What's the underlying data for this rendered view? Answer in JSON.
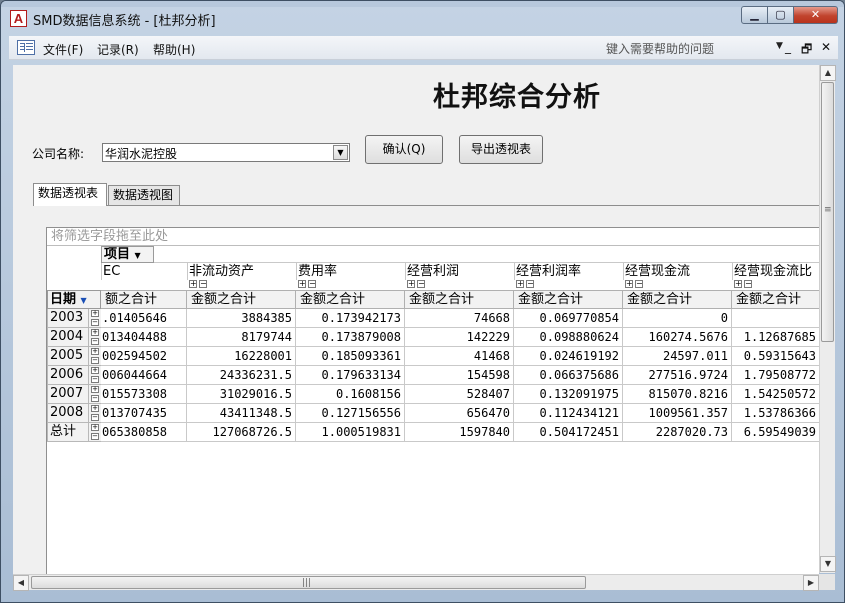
{
  "window": {
    "title": "SMD数据信息系统 - [杜邦分析]",
    "app_icon_letter": "A"
  },
  "caption": {
    "min": "▁",
    "max": "▢",
    "close": "✕"
  },
  "menu": {
    "items": [
      "文件(F)",
      "记录(R)",
      "帮助(H)"
    ],
    "help_placeholder": "键入需要帮助的问题",
    "help_arrow": "▼",
    "mdi": {
      "min": "_",
      "restore": "🗗",
      "close": "✕"
    }
  },
  "form": {
    "title": "杜邦综合分析",
    "company_label": "公司名称:",
    "company_value": "华润水泥控股",
    "combo_arrow": "▼",
    "confirm_button": "确认(Q)",
    "export_button": "导出透视表",
    "tabs": [
      "数据透视表",
      "数据透视图"
    ]
  },
  "pivot": {
    "filter_hint": "将筛选字段拖至此处",
    "items_header": "项目",
    "dropdown_glyph": "▼",
    "row_header": "日期",
    "plus": "+",
    "minus": "−",
    "columns": [
      "EC",
      "非流动资产",
      "费用率",
      "经营利润",
      "经营利润率",
      "经营现金流",
      "经营现金流比"
    ],
    "subheaders": [
      "额之合计",
      "金额之合计",
      "金额之合计",
      "金额之合计",
      "金额之合计",
      "金额之合计",
      "金额之合计"
    ],
    "rows": [
      {
        "label": "2003",
        "cells": [
          ".01405646",
          "3884385",
          "0.173942173",
          "74668",
          "0.069770854",
          "0",
          ""
        ]
      },
      {
        "label": "2004",
        "cells": [
          "013404488",
          "8179744",
          "0.173879008",
          "142229",
          "0.098880624",
          "160274.5676",
          "1.12687685"
        ]
      },
      {
        "label": "2005",
        "cells": [
          "002594502",
          "16228001",
          "0.185093361",
          "41468",
          "0.024619192",
          "24597.011",
          "0.59315643"
        ]
      },
      {
        "label": "2006",
        "cells": [
          "006044664",
          "24336231.5",
          "0.179633134",
          "154598",
          "0.066375686",
          "277516.9724",
          "1.79508772"
        ]
      },
      {
        "label": "2007",
        "cells": [
          "015573308",
          "31029016.5",
          "0.1608156",
          "528407",
          "0.132091975",
          "815070.8216",
          "1.54250572"
        ]
      },
      {
        "label": "2008",
        "cells": [
          "013707435",
          "43411348.5",
          "0.127156556",
          "656470",
          "0.112434121",
          "1009561.357",
          "1.53786366"
        ]
      },
      {
        "label": "总计",
        "cells": [
          "065380858",
          "127068726.5",
          "1.000519831",
          "1597840",
          "0.504172451",
          "2287020.73",
          "6.59549039"
        ]
      }
    ]
  },
  "scroll": {
    "up": "▲",
    "down": "▼",
    "left": "◀",
    "right": "▶",
    "grip_v": "≡",
    "grip_h": "|||"
  }
}
